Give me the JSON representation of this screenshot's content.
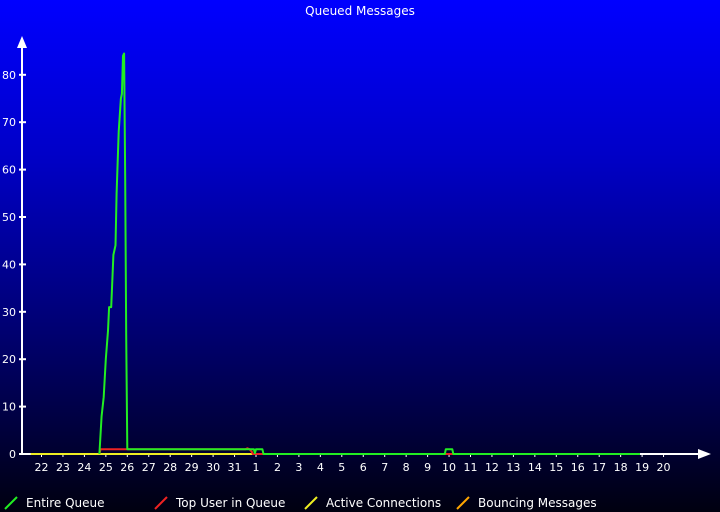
{
  "chart_data": {
    "type": "line",
    "title": "Queued Messages",
    "xlabel": "",
    "ylabel": "",
    "ylim": [
      0,
      90
    ],
    "yticks": [
      0,
      10,
      20,
      30,
      40,
      50,
      60,
      70,
      80
    ],
    "x_ticks": [
      "22",
      "23",
      "24",
      "25",
      "26",
      "27",
      "28",
      "29",
      "30",
      "31",
      "1",
      "2",
      "3",
      "4",
      "5",
      "6",
      "7",
      "8",
      "9",
      "10",
      "11",
      "12",
      "13",
      "14",
      "15",
      "16",
      "17",
      "18",
      "19",
      "20"
    ],
    "grid": false,
    "legend_position": "bottom",
    "series": [
      {
        "name": "Entire Queue",
        "color": "#22ee22",
        "points": [
          [
            24.7,
            0
          ],
          [
            24.8,
            8
          ],
          [
            24.9,
            12
          ],
          [
            25.0,
            20
          ],
          [
            25.1,
            26
          ],
          [
            25.15,
            31
          ],
          [
            25.25,
            31
          ],
          [
            25.35,
            42
          ],
          [
            25.45,
            44
          ],
          [
            25.5,
            55
          ],
          [
            25.6,
            68
          ],
          [
            25.7,
            75
          ],
          [
            25.75,
            76
          ],
          [
            25.8,
            84
          ],
          [
            25.85,
            84.5
          ],
          [
            25.9,
            58
          ],
          [
            25.95,
            25
          ],
          [
            26.0,
            1
          ],
          [
            31.9,
            1
          ],
          [
            31.95,
            0.2
          ],
          [
            32.0,
            1
          ],
          [
            32.3,
            1
          ],
          [
            32.35,
            0
          ],
          [
            40.8,
            0
          ],
          [
            40.85,
            1
          ],
          [
            41.15,
            1
          ],
          [
            41.2,
            0
          ],
          [
            49.9,
            0
          ]
        ]
      },
      {
        "name": "Top User in Queue",
        "color": "#ee2222",
        "points": [
          [
            24.7,
            0
          ],
          [
            24.75,
            1
          ],
          [
            31.5,
            1
          ],
          [
            31.6,
            1.2
          ],
          [
            31.7,
            1
          ],
          [
            31.8,
            0.5
          ],
          [
            31.85,
            0
          ],
          [
            49.9,
            0
          ]
        ]
      },
      {
        "name": "Active Connections",
        "color": "#eeee22",
        "points": [
          [
            21.5,
            0
          ],
          [
            49.9,
            0
          ]
        ]
      },
      {
        "name": "Bouncing Messages",
        "color": "#ffa500",
        "points": [
          [
            21.5,
            0
          ],
          [
            49.9,
            0
          ]
        ]
      }
    ]
  }
}
